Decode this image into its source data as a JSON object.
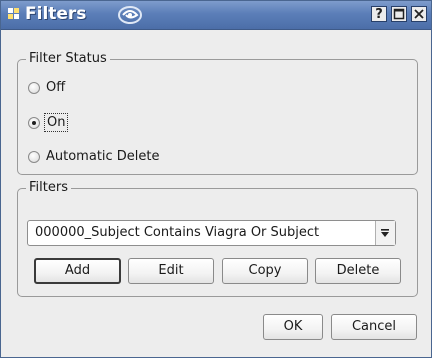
{
  "window": {
    "title": "Filters",
    "help_button": "?",
    "icons": {
      "app": "app-icon",
      "swirl": "swirl-icon",
      "help": "help-icon",
      "maximize": "maximize-icon",
      "close": "close-icon"
    }
  },
  "filter_status": {
    "legend": "Filter Status",
    "options": [
      {
        "label": "Off",
        "selected": false
      },
      {
        "label": "On",
        "selected": true
      },
      {
        "label": "Automatic Delete",
        "selected": false
      }
    ]
  },
  "filters": {
    "legend": "Filters",
    "selected": "000000_Subject Contains Viagra Or Subject",
    "buttons": {
      "add": "Add",
      "edit": "Edit",
      "copy": "Copy",
      "delete": "Delete"
    }
  },
  "dialog": {
    "ok": "OK",
    "cancel": "Cancel"
  },
  "colors": {
    "titlebar": "#5b7eb8",
    "dialog_bg": "#ededed"
  }
}
